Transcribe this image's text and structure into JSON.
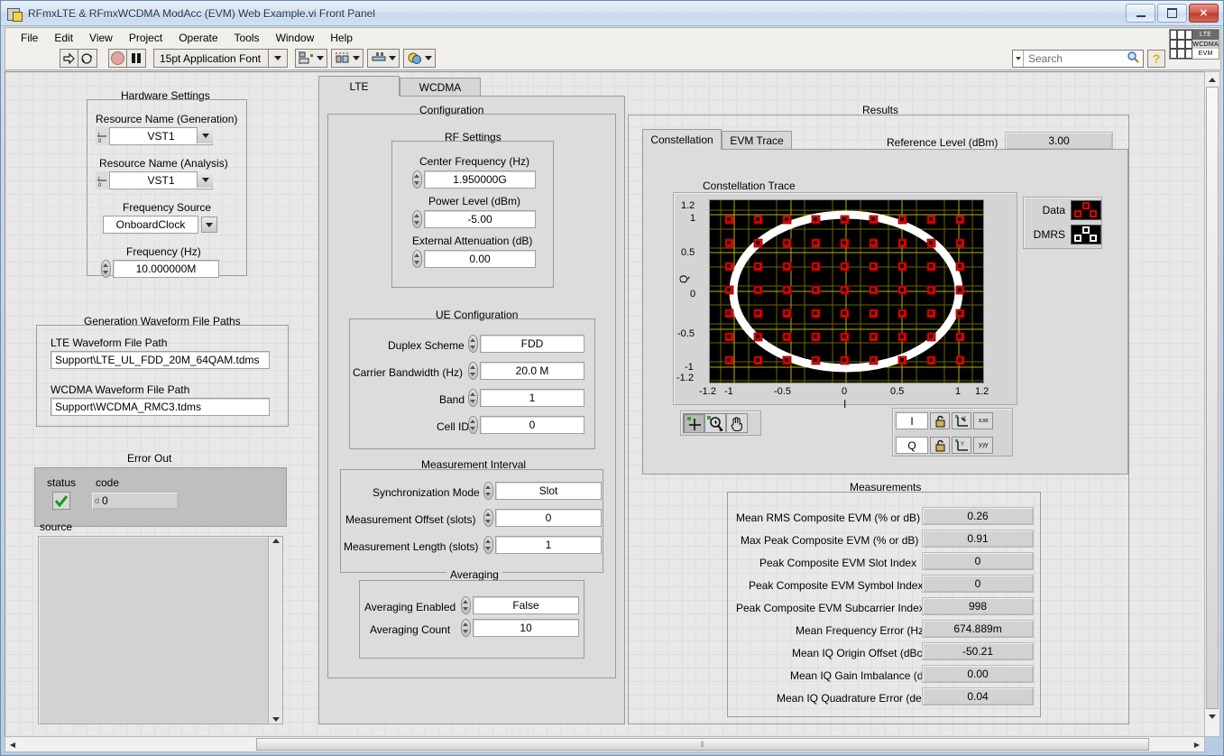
{
  "window": {
    "title": "RFmxLTE & RFmxWCDMA ModAcc (EVM) Web Example.vi Front Panel",
    "minimize_label": "",
    "maximize_label": "",
    "close_label": "✕"
  },
  "menubar": [
    "File",
    "Edit",
    "View",
    "Project",
    "Operate",
    "Tools",
    "Window",
    "Help"
  ],
  "toolbar": {
    "run_icon": "run-arrow-icon",
    "run_continuous_icon": "run-continuously-icon",
    "abort_icon": "abort-execution-icon",
    "pause_icon": "pause-icon",
    "font_selector": "15pt Application Font",
    "align_icon": "align-objects-icon",
    "distribute_icon": "distribute-objects-icon",
    "resize_icon": "resize-objects-icon",
    "reorder_icon": "reorder-objects-icon",
    "search_placeholder": "Search",
    "search_value": "",
    "search_icon": "magnifier-icon",
    "help_icon": "question-mark-icon"
  },
  "vi_icon": {
    "line1": "LTE",
    "line2": "WCDMA",
    "line3": "EVM"
  },
  "left_panel": {
    "hardware_settings": {
      "title": "Hardware Settings",
      "fields": [
        {
          "label": "Resource Name (Generation)",
          "value": "VST1",
          "type": "io-ring"
        },
        {
          "label": "Resource Name (Analysis)",
          "value": "VST1",
          "type": "io-ring"
        },
        {
          "label": "Frequency Source",
          "value": "OnboardClock",
          "type": "combo"
        },
        {
          "label": "Frequency (Hz)",
          "value": "10.000000M",
          "type": "numeric"
        }
      ]
    },
    "waveform_paths": {
      "title": "Generation Waveform File Paths",
      "fields": [
        {
          "label": "LTE Waveform File Path",
          "value": "Support\\LTE_UL_FDD_20M_64QAM.tdms"
        },
        {
          "label": "WCDMA Waveform File Path",
          "value": "Support\\WCDMA_RMC3.tdms"
        }
      ]
    },
    "error_out": {
      "title": "Error Out",
      "status_label": "status",
      "status_value": "no-error",
      "status_icon": "green-check-icon",
      "code_label": "code",
      "code_value": "0",
      "source_label": "source",
      "source_value": ""
    }
  },
  "center_panel": {
    "tabs": [
      {
        "label": "LTE",
        "active": true
      },
      {
        "label": "WCDMA",
        "active": false
      }
    ],
    "configuration_title": "Configuration",
    "rf_settings": {
      "title": "RF Settings",
      "fields": [
        {
          "label": "Center Frequency (Hz)",
          "value": "1.950000G"
        },
        {
          "label": "Power Level (dBm)",
          "value": "-5.00"
        },
        {
          "label": "External Attenuation (dB)",
          "value": "0.00"
        }
      ]
    },
    "ue_configuration": {
      "title": "UE Configuration",
      "fields": [
        {
          "label": "Duplex Scheme",
          "value": "FDD"
        },
        {
          "label": "Carrier Bandwidth (Hz)",
          "value": "20.0 M"
        },
        {
          "label": "Band",
          "value": "1"
        },
        {
          "label": "Cell ID",
          "value": "0"
        }
      ]
    },
    "measurement_interval": {
      "title": "Measurement Interval",
      "fields": [
        {
          "label": "Synchronization Mode",
          "value": "Slot"
        },
        {
          "label": "Measurement Offset (slots)",
          "value": "0"
        },
        {
          "label": "Measurement Length (slots)",
          "value": "1"
        }
      ]
    },
    "averaging": {
      "title": "Averaging",
      "fields": [
        {
          "label": "Averaging Enabled",
          "value": "False"
        },
        {
          "label": "Averaging Count",
          "value": "10"
        }
      ]
    }
  },
  "results_panel": {
    "title": "Results",
    "reference_level": {
      "label": "Reference Level (dBm)",
      "value": "3.00"
    },
    "tabs": [
      {
        "label": "Constellation",
        "active": true
      },
      {
        "label": "EVM Trace",
        "active": false
      }
    ],
    "graph_palette": {
      "cursor_icon": "cursor-crosshair-icon",
      "zoom_icon": "zoom-magnifier-icon",
      "pan_icon": "pan-hand-icon",
      "x_name": "I",
      "y_name": "Q",
      "lock_icon": "scale-lock-icon",
      "autoscale_x_icon": "autoscale-x-icon",
      "autoscale_y_icon": "autoscale-y-icon",
      "format_x_label": "x.xx",
      "format_y_label": "y.yy"
    },
    "measurements": {
      "title": "Measurements",
      "rows": [
        {
          "label": "Mean RMS Composite EVM (% or dB)",
          "value": "0.26"
        },
        {
          "label": "Max Peak Composite EVM (% or dB)",
          "value": "0.91"
        },
        {
          "label": "Peak Composite EVM Slot Index",
          "value": "0"
        },
        {
          "label": "Peak Composite EVM Symbol Index",
          "value": "0"
        },
        {
          "label": "Peak Composite EVM Subcarrier Index",
          "value": "998"
        },
        {
          "label": "Mean Frequency Error (Hz)",
          "value": "674.889m"
        },
        {
          "label": "Mean IQ Origin Offset (dBc)",
          "value": "-50.21"
        },
        {
          "label": "Mean IQ Gain Imbalance (dB)",
          "value": "0.00"
        },
        {
          "label": "Mean IQ Quadrature Error (deg)",
          "value": "0.04"
        }
      ]
    }
  },
  "chart_data": {
    "type": "scatter",
    "title": "Constellation Trace",
    "xlabel": "I",
    "ylabel": "Q",
    "xlim": [
      -1.2,
      1.2
    ],
    "ylim": [
      -1.2,
      1.2
    ],
    "xticks": [
      -1.2,
      -1,
      -0.5,
      0,
      0.5,
      1,
      1.2
    ],
    "yticks": [
      -1.2,
      -1,
      -0.5,
      0,
      0.5,
      1,
      1.2
    ],
    "grid": true,
    "plot_bg": "#000000",
    "grid_color": "#b8b000",
    "minor_grid_color": "#6a6600",
    "legend_position": "right",
    "series": [
      {
        "name": "Data",
        "color": "#e00000",
        "marker": "square",
        "modulation": "64QAM",
        "levels": [
          -1.08,
          -0.772,
          -0.463,
          -0.154,
          0.154,
          0.463,
          0.772,
          1.08
        ],
        "description": "64 constellation points on an 8x8 grid at the listed I/Q levels"
      },
      {
        "name": "DMRS",
        "color": "#ffffff",
        "marker": "square",
        "shape": "circle",
        "radius": 1.0,
        "description": "Zadoff-Chu reference sequence forming a unit-magnitude circle"
      }
    ]
  },
  "scrollbars": {
    "horizontal_grip": "‖",
    "left_arrow": "◀",
    "right_arrow": "▶",
    "up_arrow": "▲",
    "down_arrow": "▼"
  }
}
